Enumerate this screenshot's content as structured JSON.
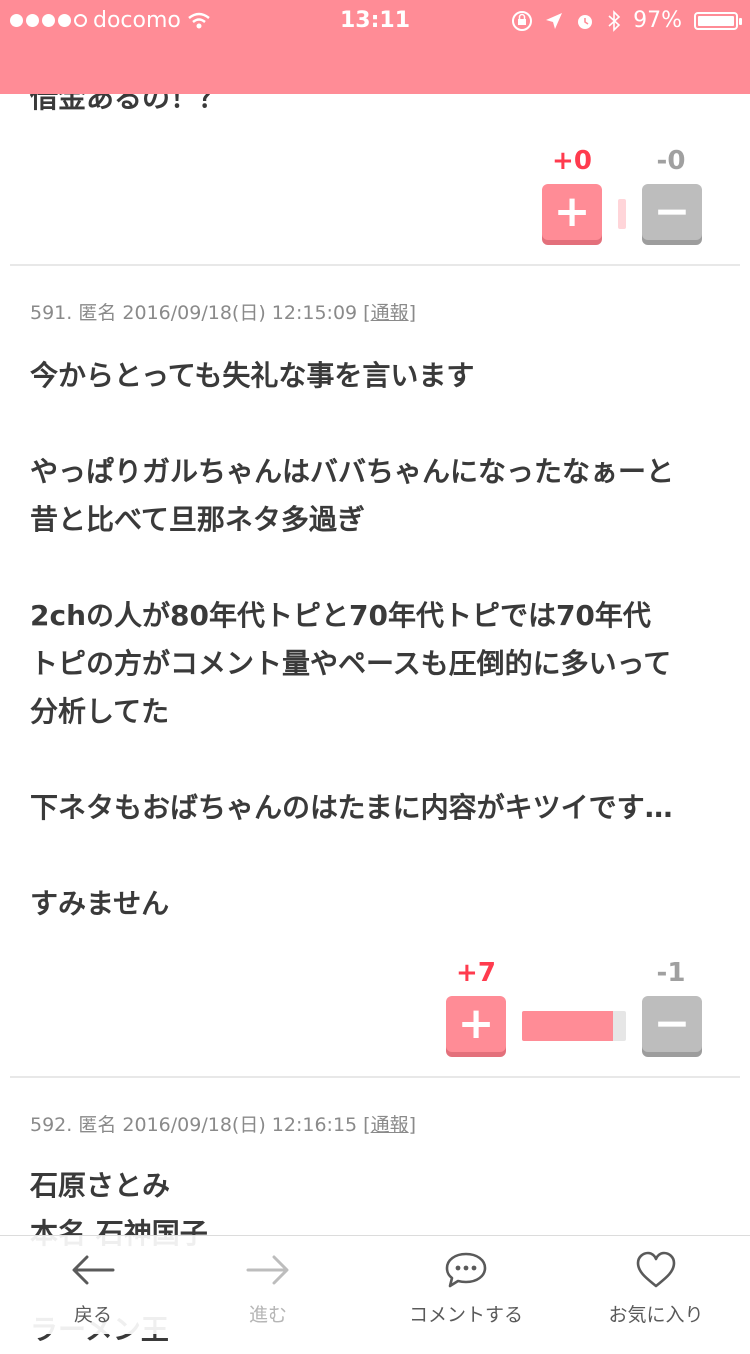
{
  "status_bar": {
    "carrier": "docomo",
    "time": "13:11",
    "battery": "97%"
  },
  "top_comment": {
    "cut_text": "借金あるの！？",
    "plus": "+0",
    "minus": "-0"
  },
  "comments": [
    {
      "number": "591.",
      "author": "匿名",
      "datetime": "2016/09/18(日) 12:15:09",
      "report": "通報",
      "lines": [
        "今からとっても失礼な事を言います",
        "",
        "やっぱりガルちゃんはババちゃんになったなぁーと",
        "昔と比べて旦那ネタ多過ぎ",
        "",
        "2chの人が80年代トピと70年代トピでは70年代",
        "トピの方がコメント量やペースも圧倒的に多いって",
        "分析してた",
        "",
        "下ネタもおばちゃんのはたまに内容がキツイです…",
        "",
        "すみません"
      ],
      "plus": "+7",
      "minus": "-1",
      "plus_ratio": 0.875
    },
    {
      "number": "592.",
      "author": "匿名",
      "datetime": "2016/09/18(日) 12:16:15",
      "report": "通報",
      "lines": [
        "石原さとみ",
        "本名 石神国子",
        "",
        "ラーメン王"
      ]
    }
  ],
  "toolbar": {
    "back": "戻る",
    "forward": "進む",
    "comment": "コメントする",
    "favorite": "お気に入り"
  },
  "colors": {
    "accent": "#ff8c96",
    "plus_text": "#ff3b4e",
    "minus": "#bdbdbd"
  }
}
